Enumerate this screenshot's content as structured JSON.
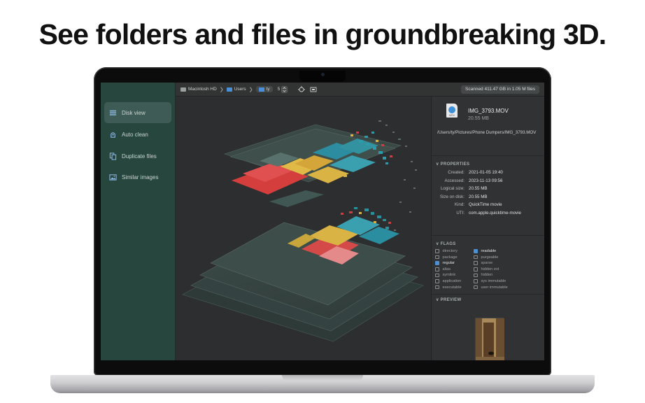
{
  "headline": "See folders and files in groundbreaking 3D.",
  "sidebar": {
    "items": [
      {
        "label": "Disk view",
        "icon": "disk-view-icon",
        "active": true
      },
      {
        "label": "Auto clean",
        "icon": "auto-clean-icon",
        "active": false
      },
      {
        "label": "Duplicate files",
        "icon": "duplicate-files-icon",
        "active": false
      },
      {
        "label": "Similar images",
        "icon": "similar-images-icon",
        "active": false
      }
    ]
  },
  "toolbar": {
    "breadcrumb": [
      "Macintosh HD",
      "Users",
      "ty"
    ],
    "depth_value": "5",
    "scan_status": "Scanned 411.47 GB in 1.05 M files"
  },
  "inspector": {
    "file_name": "IMG_3793.MOV",
    "file_icon_label": "MOV",
    "file_size": "20.55 MB",
    "file_path": "/Users/ty/Pictures/Phone Dumpers/IMG_3793.MOV",
    "properties_title": "PROPERTIES",
    "properties": [
      {
        "key": "Created:",
        "value": "2021-01-05 19:40"
      },
      {
        "key": "Accessed:",
        "value": "2023-11-13 09:56"
      },
      {
        "key": "Logical size:",
        "value": "20.55 MB"
      },
      {
        "key": "Size on disk:",
        "value": "20.55 MB"
      },
      {
        "key": "Kind:",
        "value": "QuickTime movie"
      },
      {
        "key": "UTI:",
        "value": "com.apple.quicktime-movie"
      }
    ],
    "flags_title": "FLAGS",
    "flags_left": [
      {
        "label": "directory",
        "checked": false
      },
      {
        "label": "package",
        "checked": false
      },
      {
        "label": "regular",
        "checked": true
      },
      {
        "label": "alias",
        "checked": false
      },
      {
        "label": "symlink",
        "checked": false
      },
      {
        "label": "application",
        "checked": false
      },
      {
        "label": "executable",
        "checked": false
      }
    ],
    "flags_right": [
      {
        "label": "readable",
        "checked": true
      },
      {
        "label": "purgeable",
        "checked": false
      },
      {
        "label": "sparse",
        "checked": false
      },
      {
        "label": "hidden ext",
        "checked": false
      },
      {
        "label": "hidden",
        "checked": false
      },
      {
        "label": "sys immutable",
        "checked": false
      },
      {
        "label": "user immutable",
        "checked": false
      }
    ],
    "preview_title": "PREVIEW"
  },
  "colors": {
    "sidebar_bg": "#27463e",
    "sidebar_active": "#3e5c55",
    "tile_red": "#d8423f",
    "tile_yellow": "#e0b840",
    "tile_teal": "#2a98a8",
    "accent_blue": "#4d8fd3"
  }
}
